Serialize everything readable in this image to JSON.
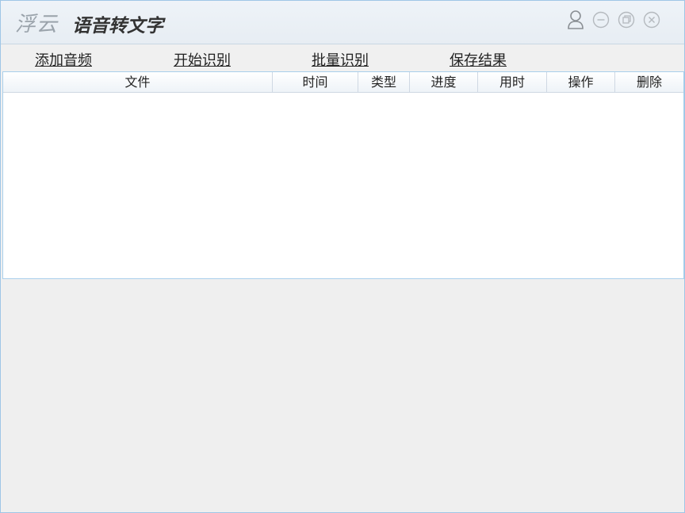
{
  "app": {
    "brand_prefix": "浮云",
    "title": "语音转文字"
  },
  "window_controls": {
    "icons": [
      "user-icon",
      "minimize-icon",
      "restore-icon",
      "close-icon"
    ]
  },
  "toolbar": {
    "add_audio": "添加音频",
    "start_recognition": "开始识别",
    "batch_recognition": "批量识别",
    "save_results": "保存结果"
  },
  "table": {
    "columns": [
      "文件",
      "时间",
      "类型",
      "进度",
      "用时",
      "操作",
      "删除"
    ],
    "rows": []
  },
  "colors": {
    "accent_border": "#9fc6e6",
    "icon_gray": "#a4a9ae"
  }
}
